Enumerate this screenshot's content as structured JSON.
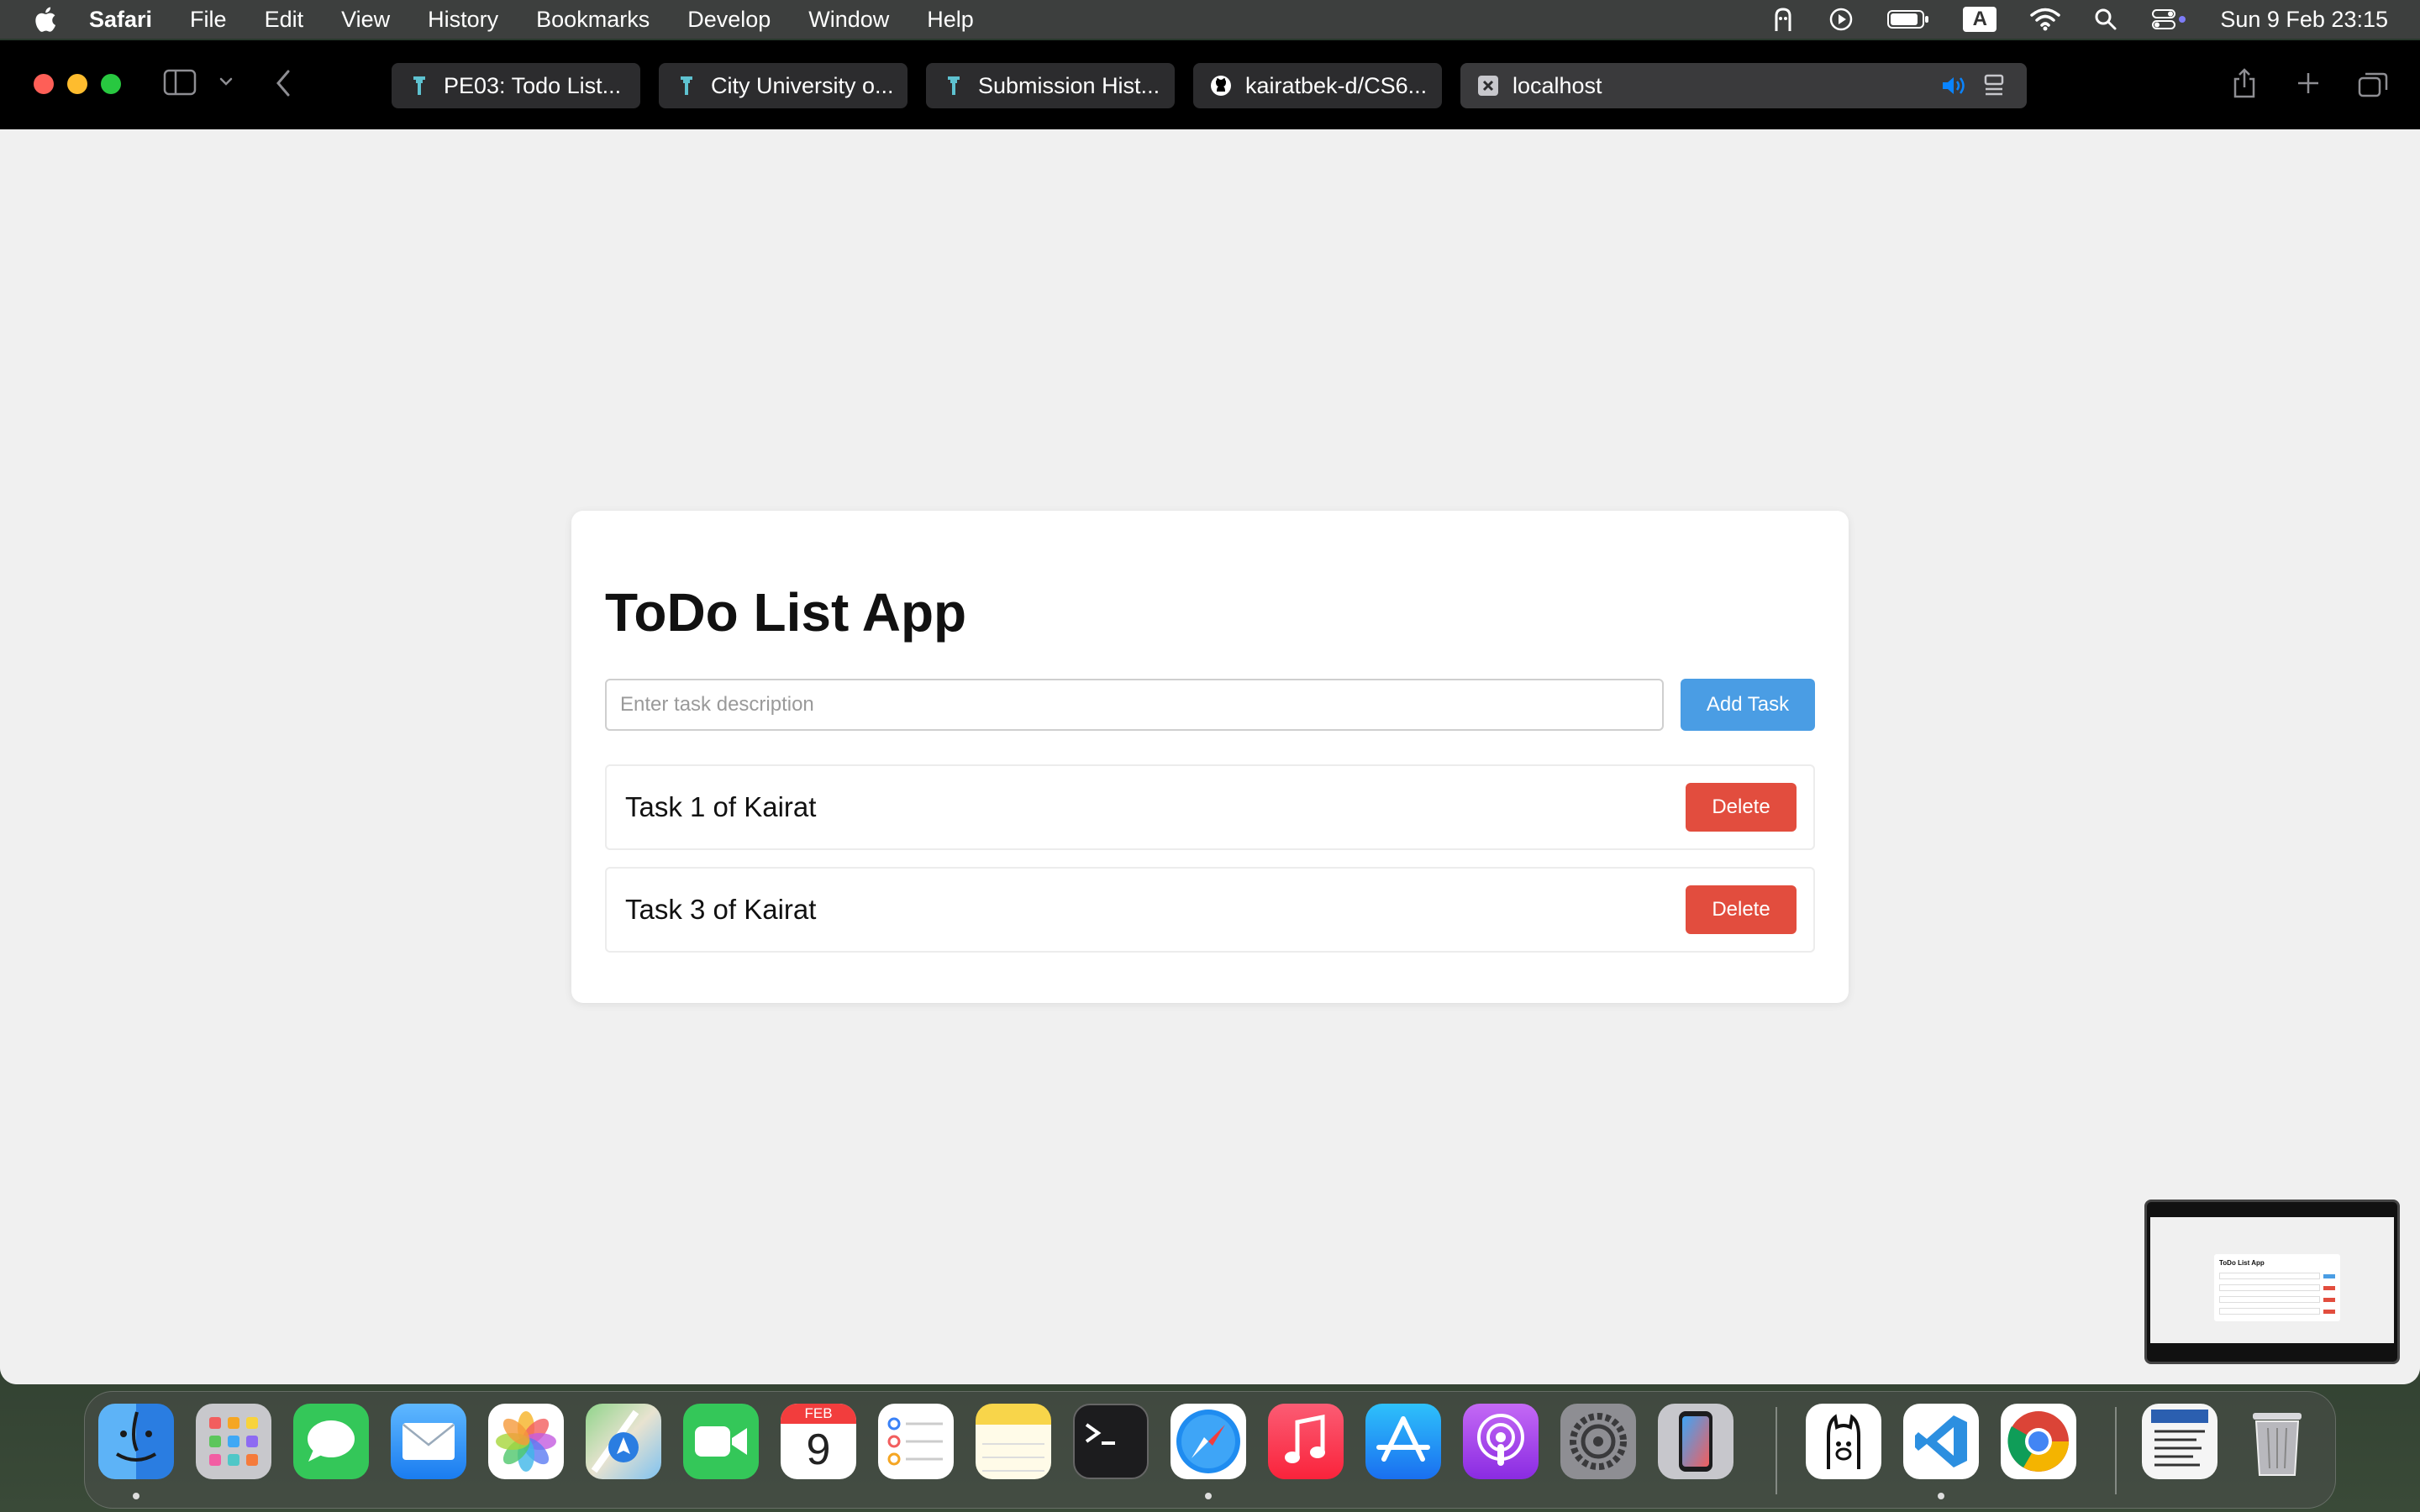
{
  "menubar": {
    "app_name": "Safari",
    "items": [
      "File",
      "Edit",
      "View",
      "History",
      "Bookmarks",
      "Develop",
      "Window",
      "Help"
    ],
    "input_source": "A",
    "datetime": "Sun 9 Feb  23:15"
  },
  "browser": {
    "tabs": [
      {
        "label": "PE03: Todo List...",
        "icon": "canvas-icon"
      },
      {
        "label": "City University o...",
        "icon": "canvas-icon"
      },
      {
        "label": "Submission Hist...",
        "icon": "canvas-icon"
      },
      {
        "label": "kairatbek-d/CS6...",
        "icon": "github-icon"
      },
      {
        "label": "localhost",
        "icon": "close-tab-icon",
        "active": true
      }
    ]
  },
  "todo": {
    "title": "ToDo List App",
    "input_placeholder": "Enter task description",
    "input_value": "",
    "add_label": "Add Task",
    "tasks": [
      {
        "text": "Task 1 of Kairat",
        "delete_label": "Delete"
      },
      {
        "text": "Task 3 of Kairat",
        "delete_label": "Delete"
      }
    ]
  },
  "thumbnail": {
    "title": "ToDo List App"
  },
  "dock": {
    "calendar_month": "FEB",
    "calendar_day": "9",
    "apps": [
      "Finder",
      "Launchpad",
      "Messages",
      "Mail",
      "Photos",
      "Maps",
      "FaceTime",
      "Calendar",
      "Reminders",
      "Notes",
      "Terminal",
      "Safari",
      "Music",
      "App Store",
      "Podcasts",
      "System Settings",
      "iPhone Mirroring",
      "Ollama",
      "Visual Studio Code",
      "Google Chrome",
      "Document",
      "Trash"
    ]
  },
  "colors": {
    "add_button": "#4a9de4",
    "delete_button": "#e24d3e",
    "page_background": "#f0f0f0"
  }
}
